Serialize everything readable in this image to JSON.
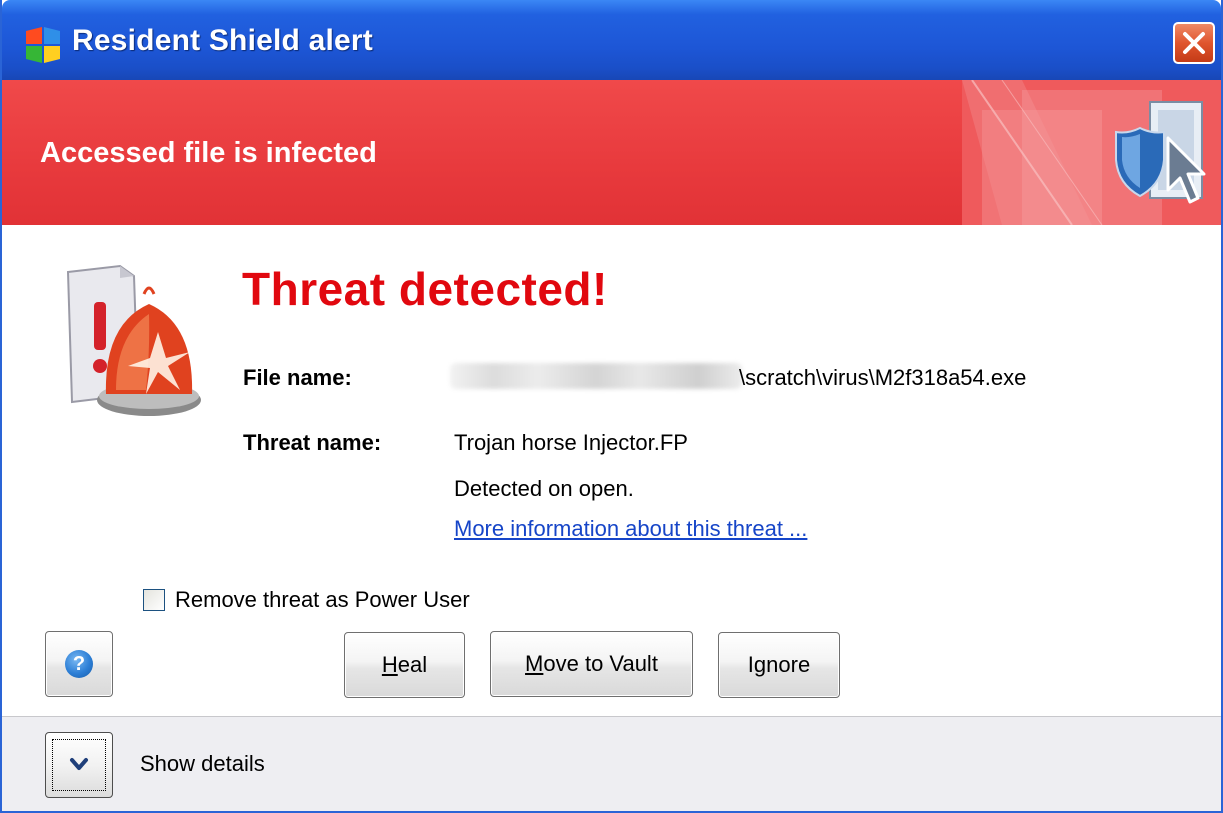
{
  "window": {
    "title": "Resident Shield alert"
  },
  "banner": {
    "text": "Accessed file is infected"
  },
  "main": {
    "heading": "Threat detected!",
    "file_name_label": "File name:",
    "file_name_value": "\\scratch\\virus\\M2f318a54.exe",
    "threat_name_label": "Threat name:",
    "threat_name_value": "Trojan horse Injector.FP",
    "detected_text": "Detected on open.",
    "more_info_link": "More information about this threat ..."
  },
  "checkbox": {
    "label": "Remove threat as Power User",
    "checked": false
  },
  "buttons": {
    "help_glyph": "?",
    "heal_accel": "H",
    "heal_rest": "eal",
    "vault_accel": "M",
    "vault_rest": "ove to Vault",
    "ignore": "Ignore"
  },
  "footer": {
    "show_details": "Show details"
  },
  "colors": {
    "title_bar": "#2161e0",
    "banner": "#e83a3d",
    "heading": "#e1080f",
    "link": "#1645c8"
  },
  "icons": [
    "avg-app-icon",
    "close-icon",
    "shield-cursor-icon",
    "siren-icon",
    "help-icon",
    "chevron-down-icon"
  ]
}
